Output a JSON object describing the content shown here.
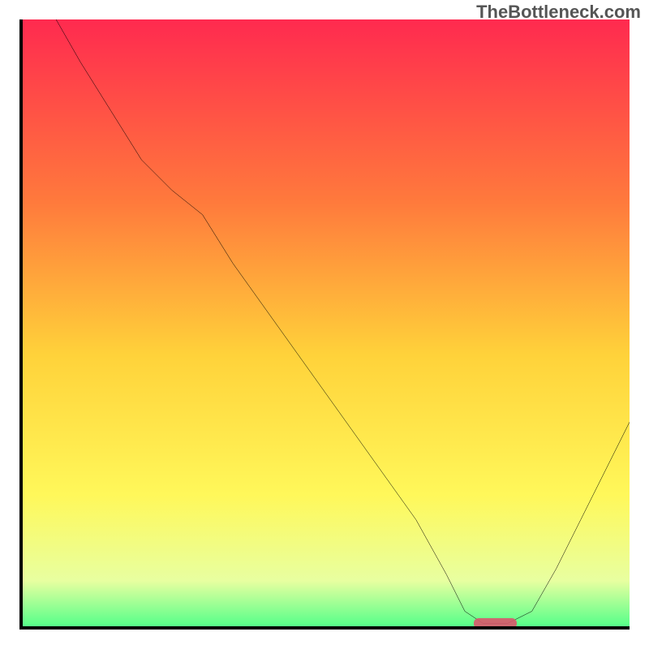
{
  "watermark": "TheBottleneck.com",
  "chart_data": {
    "type": "line",
    "title": "",
    "xlabel": "",
    "ylabel": "",
    "x_range": [
      0,
      100
    ],
    "y_range": [
      0,
      100
    ],
    "grid": false,
    "background_gradient": {
      "top": "#ff2a4f",
      "upper_mid": "#ff7a3c",
      "mid": "#ffd23a",
      "lower_mid": "#fff85a",
      "near_bottom": "#e8ffa0",
      "bottom": "#4bff88"
    },
    "series": [
      {
        "name": "bottleneck-curve",
        "color": "#000000",
        "x": [
          6,
          10,
          15,
          20,
          25,
          30,
          35,
          40,
          45,
          50,
          55,
          60,
          65,
          70,
          73,
          76,
          80,
          84,
          88,
          92,
          96,
          100
        ],
        "values": [
          100,
          93,
          85,
          77,
          72,
          68,
          60,
          53,
          46,
          39,
          32,
          25,
          18,
          9,
          3,
          1,
          1,
          3,
          10,
          18,
          26,
          34
        ]
      }
    ],
    "annotations": [
      {
        "name": "optimal-marker",
        "shape": "rounded-bar",
        "color": "#d9566b",
        "x": 78,
        "y": 1,
        "width_pct": 7,
        "height_pct": 1.6
      }
    ]
  }
}
